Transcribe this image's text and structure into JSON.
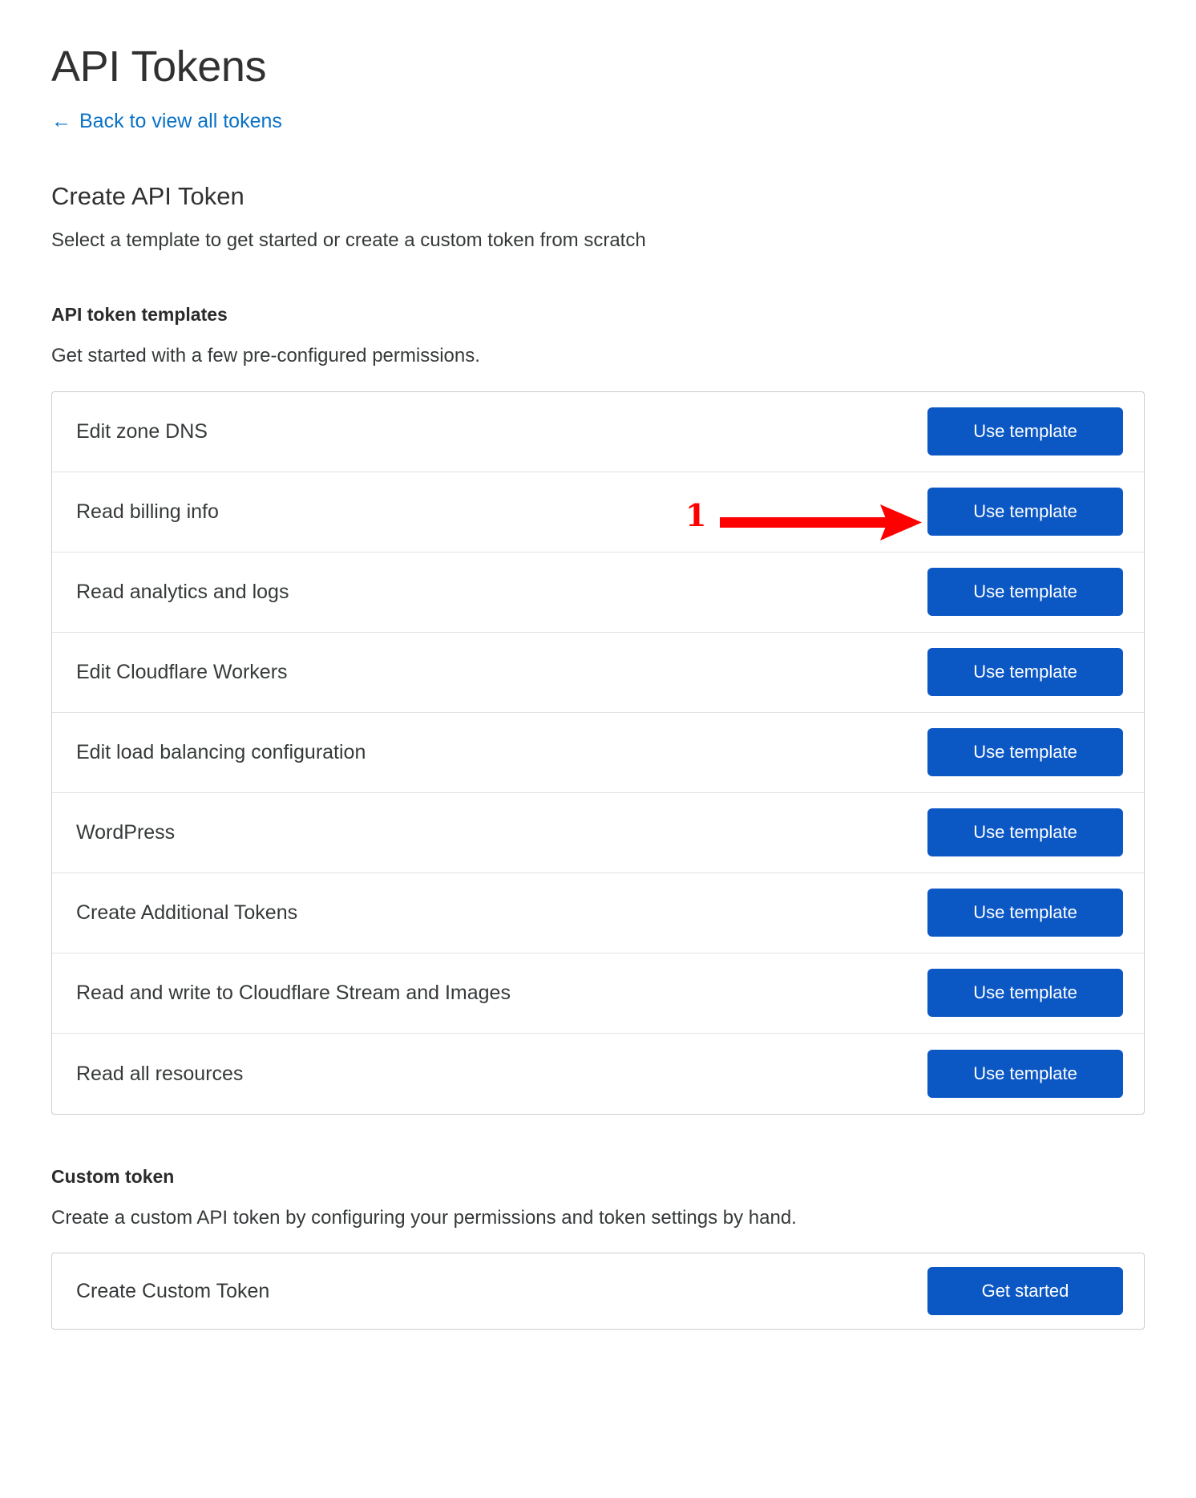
{
  "header": {
    "title": "API Tokens",
    "back_link": {
      "label": "Back to view all tokens",
      "icon": "arrow-left-icon",
      "glyph": "←",
      "color": "#0a72c7"
    }
  },
  "create_section": {
    "title": "Create API Token",
    "subtitle": "Select a template to get started or create a custom token from scratch"
  },
  "templates_section": {
    "heading": "API token templates",
    "description": "Get started with a few pre-configured permissions.",
    "button_label": "Use template",
    "rows": [
      {
        "label": "Edit zone DNS",
        "button": "Use template"
      },
      {
        "label": "Read billing info",
        "button": "Use template"
      },
      {
        "label": "Read analytics and logs",
        "button": "Use template"
      },
      {
        "label": "Edit Cloudflare Workers",
        "button": "Use template"
      },
      {
        "label": "Edit load balancing configuration",
        "button": "Use template"
      },
      {
        "label": "WordPress",
        "button": "Use template"
      },
      {
        "label": "Create Additional Tokens",
        "button": "Use template"
      },
      {
        "label": "Read and write to Cloudflare Stream and Images",
        "button": "Use template"
      },
      {
        "label": "Read all resources",
        "button": "Use template"
      }
    ]
  },
  "custom_section": {
    "heading": "Custom token",
    "description": "Create a custom API token by configuring your permissions and token settings by hand.",
    "row": {
      "label": "Create Custom Token",
      "button": "Get started"
    }
  },
  "annotation": {
    "step_number": "1",
    "icon": "arrow-right-icon",
    "color": "#ff0000",
    "points_to": "Use template"
  },
  "colors": {
    "primary_button": "#0b57c4",
    "link": "#0a72c7",
    "annotation": "#ff0000",
    "card_border": "#cdcdcd",
    "row_divider": "#e3e3e3",
    "text": "#36393a"
  }
}
